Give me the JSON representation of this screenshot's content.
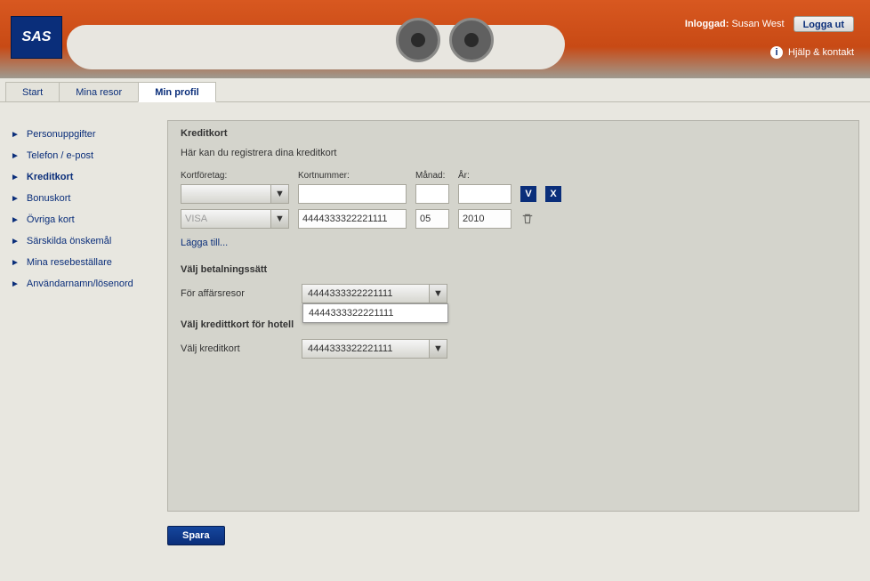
{
  "header": {
    "brand": "SAS",
    "login_prefix": "Inloggad:",
    "login_user": "Susan West",
    "logout_label": "Logga ut",
    "help_label": "Hjälp & kontakt"
  },
  "tabs": [
    {
      "label": "Start",
      "active": false
    },
    {
      "label": "Mina resor",
      "active": false
    },
    {
      "label": "Min profil",
      "active": true
    }
  ],
  "sidebar": [
    {
      "label": "Personuppgifter",
      "active": false
    },
    {
      "label": "Telefon / e-post",
      "active": false
    },
    {
      "label": "Kreditkort",
      "active": true
    },
    {
      "label": "Bonuskort",
      "active": false
    },
    {
      "label": "Övriga kort",
      "active": false
    },
    {
      "label": "Särskilda önskemål",
      "active": false
    },
    {
      "label": "Mina resebeställare",
      "active": false
    },
    {
      "label": "Användarnamn/lösenord",
      "active": false
    }
  ],
  "panel": {
    "title": "Kreditkort",
    "hint": "Här kan du registrera dina kreditkort",
    "columns": {
      "company": "Kortföretag:",
      "number": "Kortnummer:",
      "month": "Månad:",
      "year": "År:"
    },
    "rows": [
      {
        "company": "",
        "number": "",
        "month": "",
        "year": "",
        "new": true
      },
      {
        "company": "VISA",
        "number": "4444333322221111",
        "month": "05",
        "year": "2010",
        "new": false
      }
    ],
    "add_link": "Lägga till...",
    "pay_title": "Välj betalningssätt",
    "pay_business_label": "För affärsresor",
    "pay_business_value": "4444333322221111",
    "pay_business_options": [
      "4444333322221111"
    ],
    "hotel_title": "Välj kredittkort för hotell",
    "hotel_label": "Välj kreditkort",
    "hotel_value": "4444333322221111"
  },
  "save_label": "Spara"
}
